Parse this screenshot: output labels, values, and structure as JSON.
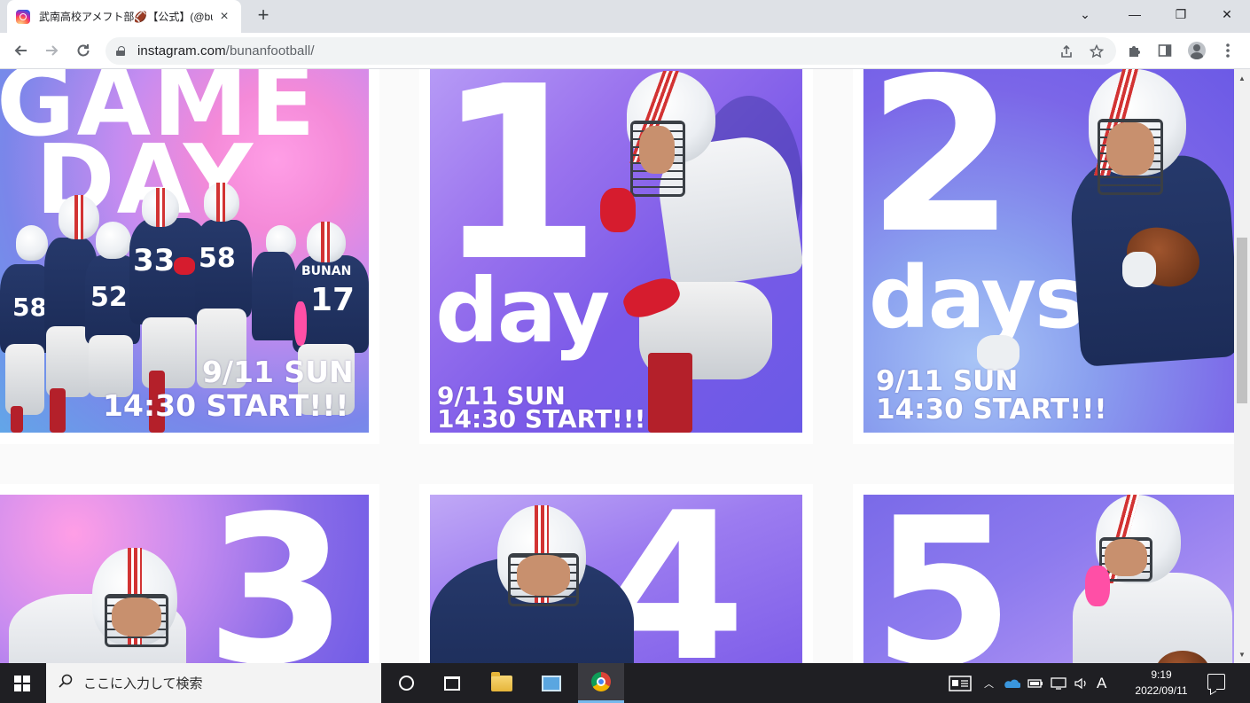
{
  "browser": {
    "tab_title": "武南高校アメフト部🏈【公式】(@bunanfootball)",
    "tab_close": "×",
    "new_tab": "+",
    "url_host": "instagram.com",
    "url_path": "/bunanfootball/",
    "window_controls": {
      "tab_search": "⌄",
      "minimize": "—",
      "restore": "❐",
      "close": "✕"
    },
    "nav_icons": {
      "back": "back-arrow-icon",
      "forward": "forward-arrow-icon",
      "reload": "reload-icon"
    }
  },
  "posts": [
    {
      "id": "game-day",
      "headline_1": "GAME",
      "headline_2": "DAY",
      "date": "9/11 SUN",
      "time": "14:30 START!!!",
      "jersey_numbers": [
        "58",
        "52",
        "33",
        "58",
        "17"
      ],
      "team": "BUNAN"
    },
    {
      "id": "1-day",
      "number": "1",
      "unit": "day",
      "date": "9/11 SUN",
      "time": "14:30 START!!!"
    },
    {
      "id": "2-days",
      "number": "2",
      "unit": "days",
      "date": "9/11 SUN",
      "time": "14:30 START!!!"
    },
    {
      "id": "3",
      "number": "3"
    },
    {
      "id": "4",
      "number": "4"
    },
    {
      "id": "5",
      "number": "5"
    }
  ],
  "taskbar": {
    "search_placeholder": "ここに入力して検索",
    "time": "9:19",
    "date": "2022/09/11",
    "ime": "A"
  }
}
